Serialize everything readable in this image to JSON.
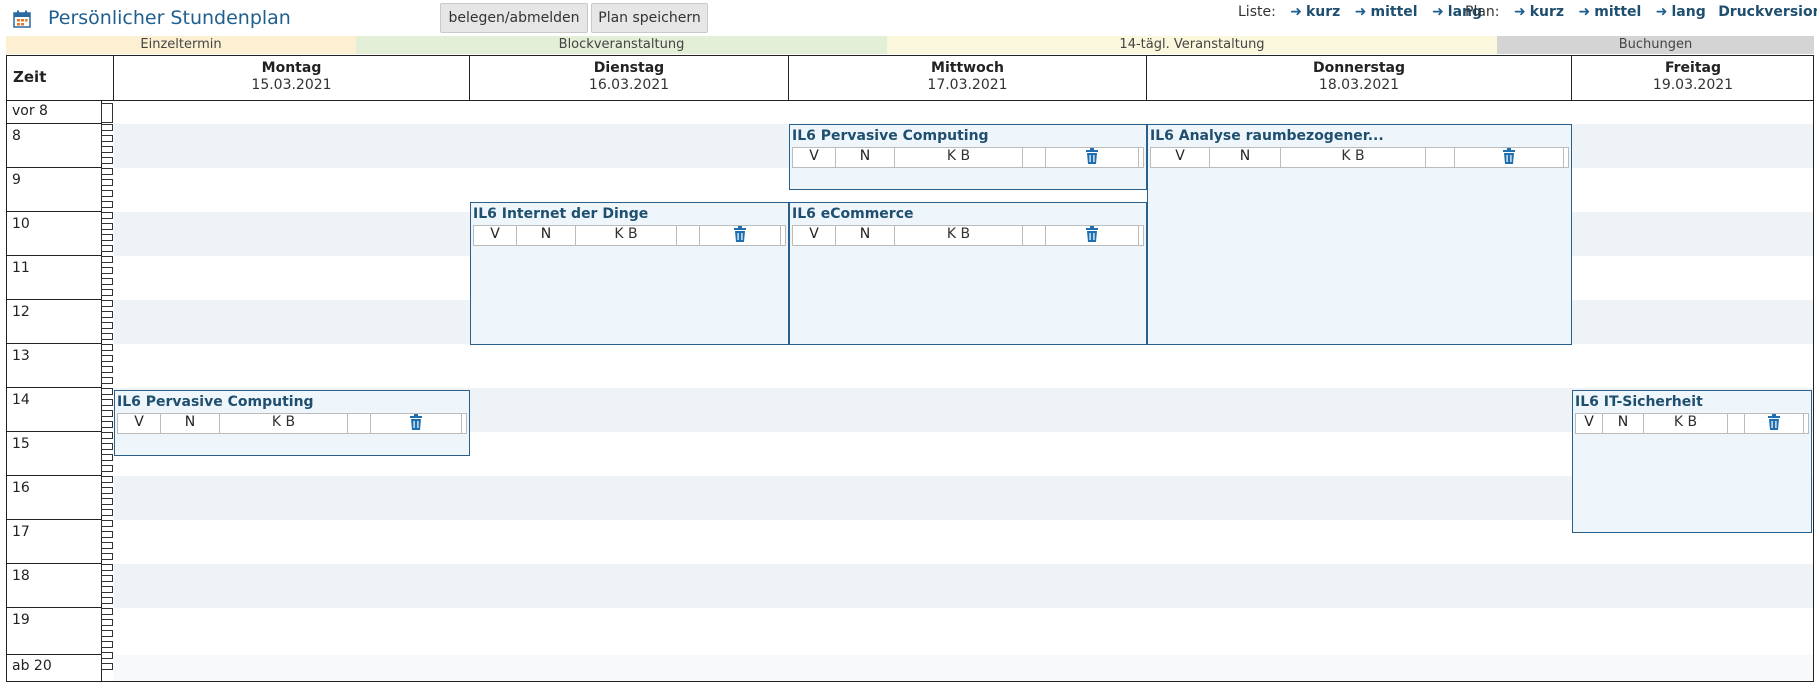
{
  "header": {
    "title": "Persönlicher Stundenplan",
    "buttons": {
      "belegen": "belegen/abmelden",
      "save": "Plan speichern"
    },
    "liste": {
      "label": "Liste:",
      "kurz": "kurz",
      "mittel": "mittel",
      "lang": "lang"
    },
    "plan": {
      "label": "Plan:",
      "kurz": "kurz",
      "mittel": "mittel",
      "lang": "lang",
      "pdf": "Druckversion (PDF)"
    }
  },
  "legend": {
    "einzel": "Einzeltermin",
    "block": "Blockveranstaltung",
    "vierzehn": "14-tägl. Veranstaltung",
    "buchungen": "Buchungen"
  },
  "zeit_label": "Zeit",
  "days": [
    {
      "name": "Montag",
      "date": "15.03.2021"
    },
    {
      "name": "Dienstag",
      "date": "16.03.2021"
    },
    {
      "name": "Mittwoch",
      "date": "17.03.2021"
    },
    {
      "name": "Donnerstag",
      "date": "18.03.2021"
    },
    {
      "name": "Freitag",
      "date": "19.03.2021"
    }
  ],
  "hours": [
    "vor 8",
    "8",
    "9",
    "10",
    "11",
    "12",
    "13",
    "14",
    "15",
    "16",
    "17",
    "18",
    "19",
    "ab 20"
  ],
  "event_row": {
    "v": "V",
    "n": "N",
    "kb": "K B"
  },
  "events": [
    {
      "title": "IL6 Pervasive Computing",
      "day": "Mittwoch"
    },
    {
      "title": "IL6 Analyse raumbezogener...",
      "day": "Donnerstag"
    },
    {
      "title": "IL6 Internet der Dinge",
      "day": "Dienstag"
    },
    {
      "title": "IL6 eCommerce",
      "day": "Mittwoch"
    },
    {
      "title": "IL6 Pervasive Computing",
      "day": "Montag"
    },
    {
      "title": "IL6 IT-Sicherheit",
      "day": "Freitag"
    }
  ],
  "colors": {
    "accent": "#1f5f8f",
    "event_border": "#2a5f8c",
    "event_bg": "#eef5fb"
  }
}
